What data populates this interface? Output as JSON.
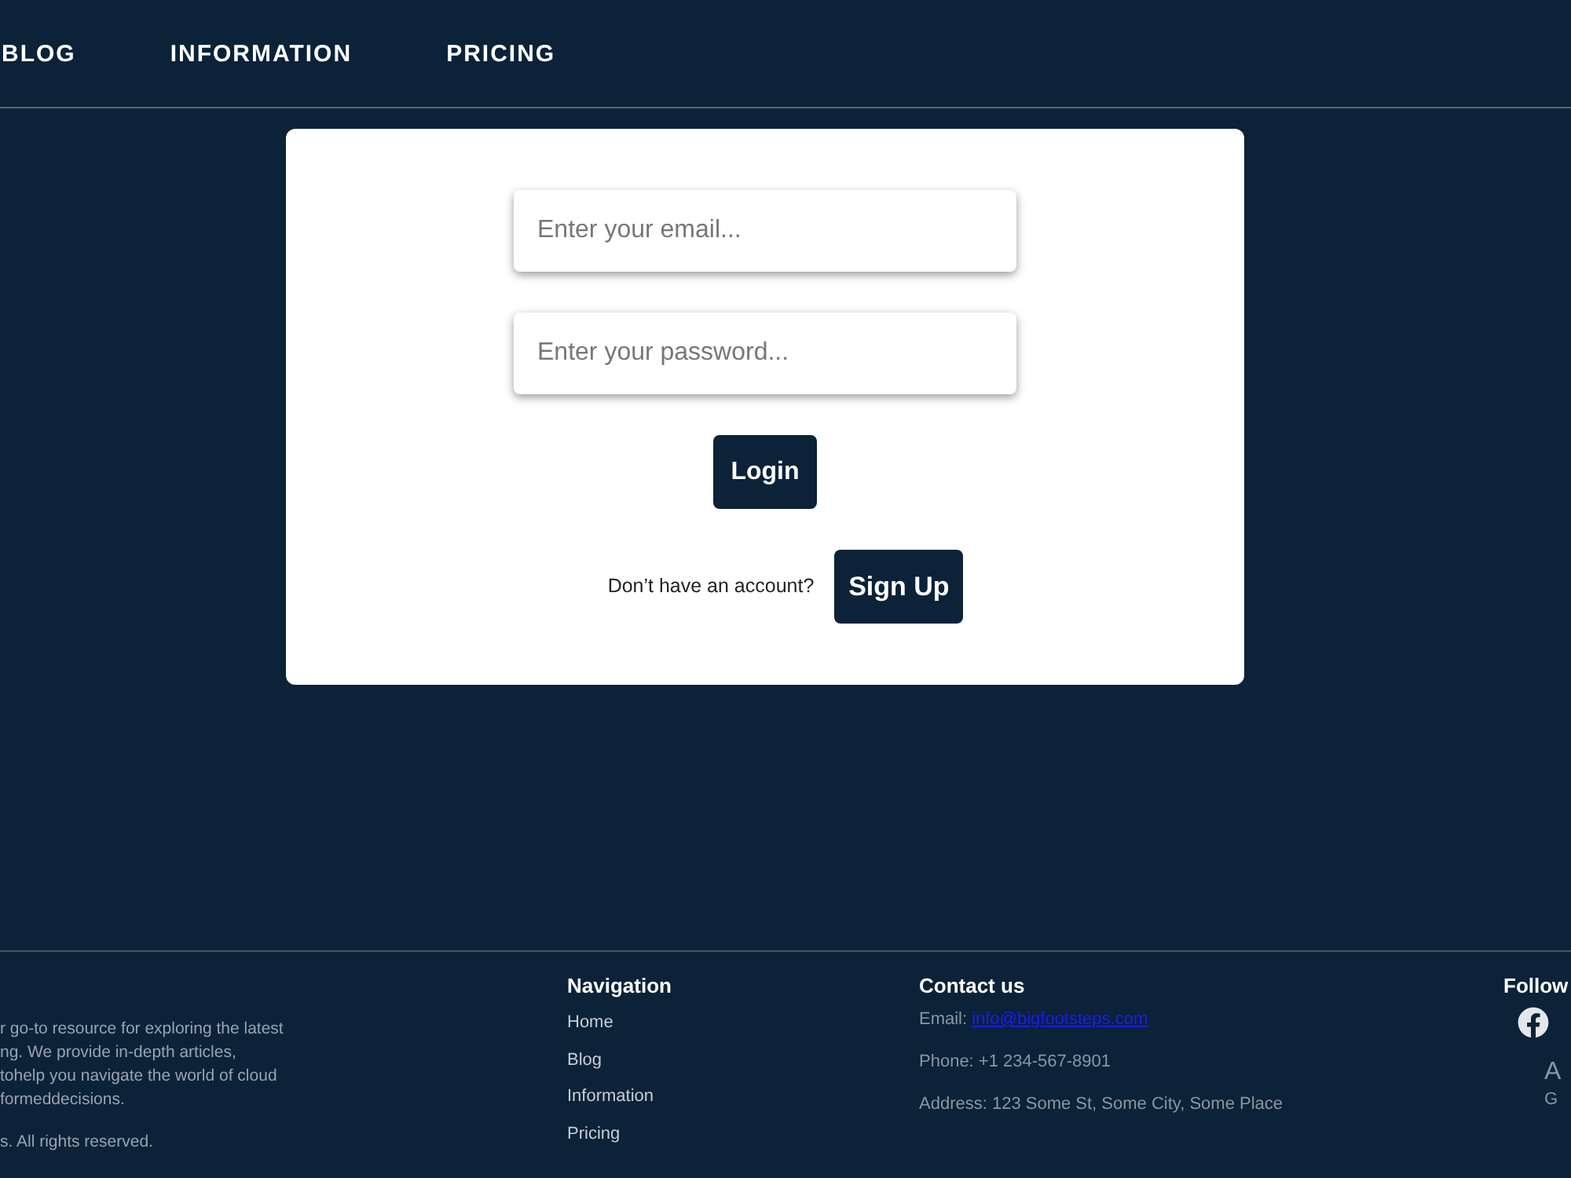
{
  "nav": {
    "links": [
      "BLOG",
      "INFORMATION",
      "PRICING"
    ]
  },
  "login_form": {
    "email": {
      "placeholder": "Enter your email..."
    },
    "password": {
      "placeholder": "Enter your password..."
    },
    "login_button": "Login",
    "signup_prompt": "Don’t have an account?",
    "signup_button": "Sign Up"
  },
  "footer": {
    "about": {
      "lines": [
        "r go-to resource for exploring the latest",
        "ng. We provide in-depth articles,",
        "tohelp you navigate the world of cloud",
        "formeddecisions."
      ],
      "copyright": "s. All rights reserved."
    },
    "navigation": {
      "title": "Navigation",
      "links": [
        "Home",
        "Blog",
        "Information",
        "Pricing"
      ]
    },
    "contact": {
      "title": "Contact us",
      "email_label": "Email:",
      "email": "info@bigfootsteps.com",
      "phone": "Phone: +1 234-567-8901",
      "address": "Address: 123 Some St, Some City, Some Place"
    },
    "follow": {
      "title": "Follow",
      "column_2_heading": "A",
      "column_2_text": "G"
    }
  }
}
